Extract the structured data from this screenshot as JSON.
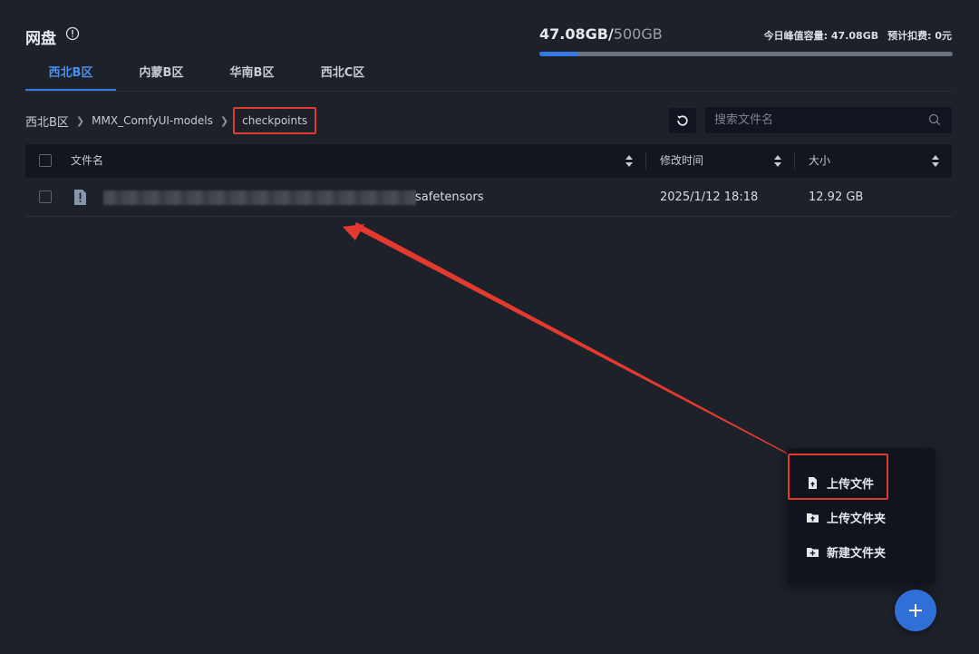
{
  "header": {
    "title": "网盘",
    "used": "47.08GB",
    "separator": "/",
    "total": "500GB",
    "usage_fraction": 0.094,
    "peak_label": "今日峰值容量: 47.08GB",
    "fee_label": "预计扣费: 0元"
  },
  "tabs": [
    {
      "label": "西北B区",
      "active": true
    },
    {
      "label": "内蒙B区",
      "active": false
    },
    {
      "label": "华南B区",
      "active": false
    },
    {
      "label": "西北C区",
      "active": false
    }
  ],
  "breadcrumb": {
    "root": "西北B区",
    "folder": "MMX_ComfyUI-models",
    "current": "checkpoints"
  },
  "search": {
    "placeholder": "搜索文件名"
  },
  "table": {
    "columns": {
      "name": "文件名",
      "modified": "修改时间",
      "size": "大小"
    },
    "rows": [
      {
        "name_suffix": "safetensors",
        "modified": "2025/1/12 18:18",
        "size": "12.92 GB"
      }
    ]
  },
  "menu": {
    "upload_file": "上传文件",
    "upload_folder": "上传文件夹",
    "new_folder": "新建文件夹"
  },
  "colors": {
    "accent": "#3478e6",
    "annotation": "#e33a2f",
    "background": "#1d2129"
  },
  "icons": [
    "info-icon",
    "chevron-right-icon",
    "refresh-icon",
    "search-icon",
    "sort-icon",
    "file-icon",
    "upload-file-icon",
    "upload-folder-icon",
    "new-folder-icon",
    "plus-icon"
  ]
}
